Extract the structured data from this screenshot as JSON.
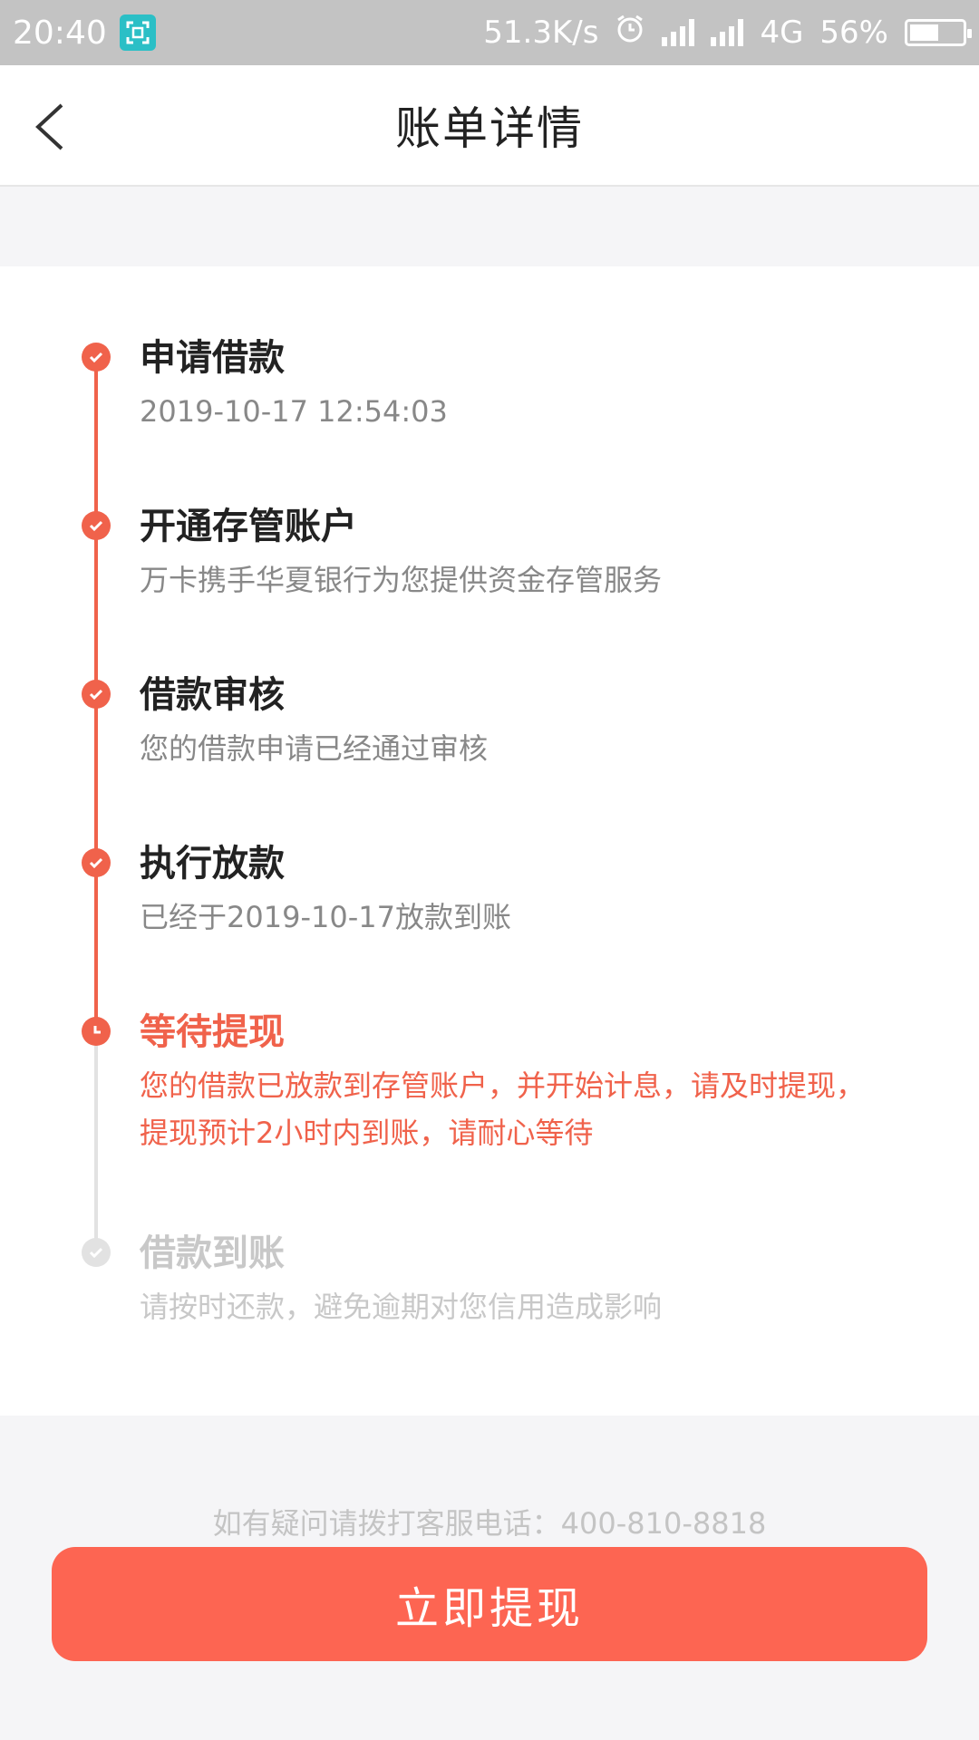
{
  "status_bar": {
    "time": "20:40",
    "speed": "51.3K/s",
    "network": "4G",
    "battery": "56%",
    "battery_level": 0.56
  },
  "header": {
    "title": "账单详情"
  },
  "steps": [
    {
      "title": "申请借款",
      "desc": "2019-10-17 12:54:03",
      "state": "done"
    },
    {
      "title": "开通存管账户",
      "desc": "万卡携手华夏银行为您提供资金存管服务",
      "state": "done"
    },
    {
      "title": "借款审核",
      "desc": "您的借款申请已经通过审核",
      "state": "done"
    },
    {
      "title": "执行放款",
      "desc": "已经于2019-10-17放款到账",
      "state": "done"
    },
    {
      "title": "等待提现",
      "desc": "您的借款已放款到存管账户，并开始计息，请及时提现，提现预计2小时内到账，请耐心等待",
      "state": "active"
    },
    {
      "title": "借款到账",
      "desc": "请按时还款，避免逾期对您信用造成影响",
      "state": "pending"
    }
  ],
  "footer": {
    "service_text": "如有疑问请拨打客服电话：400-810-8818",
    "button_label": "立即提现"
  },
  "colors": {
    "accent": "#f0624b",
    "button": "#fd6552",
    "pending": "#e2e2e2"
  }
}
